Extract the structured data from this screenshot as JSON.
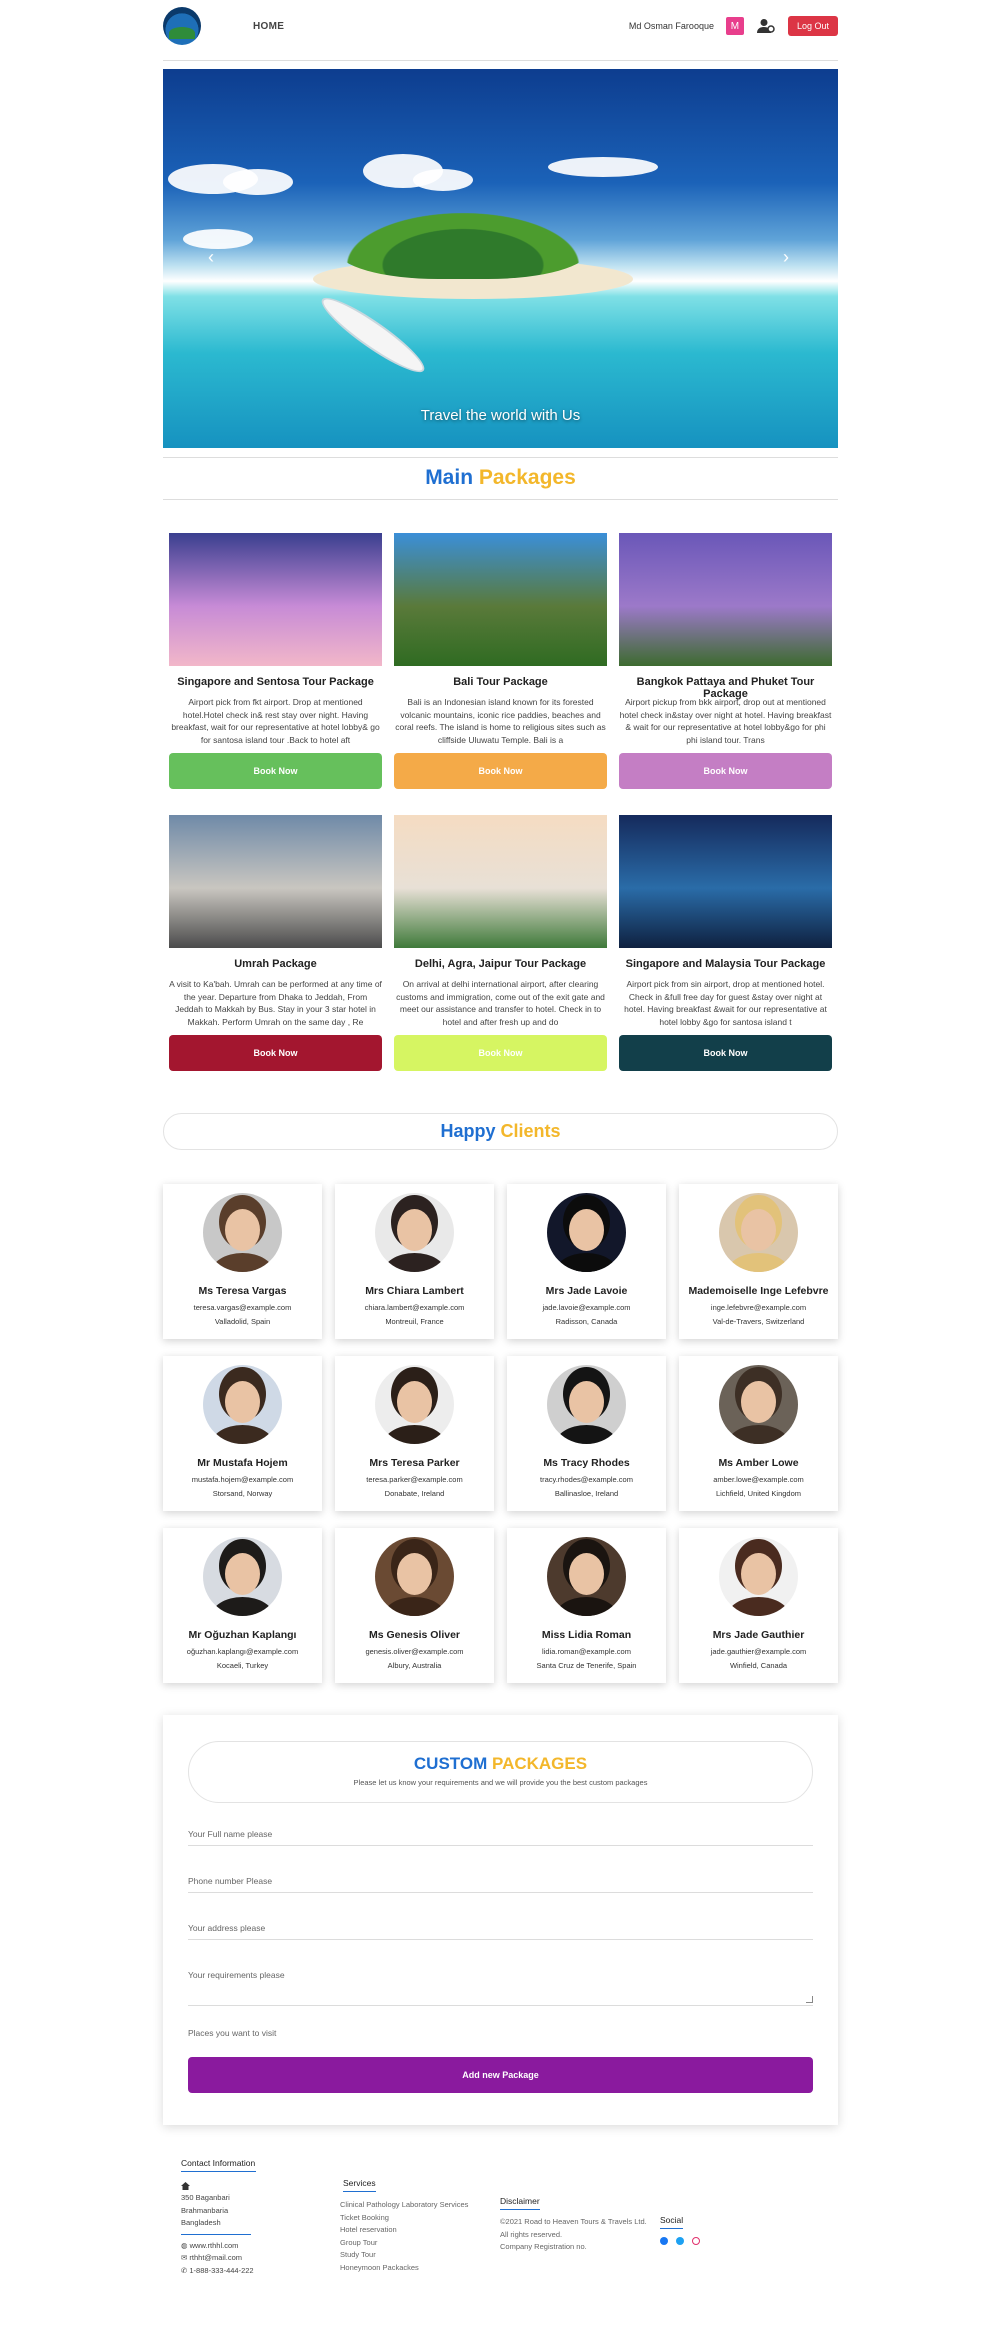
{
  "nav": {
    "home": "HOME",
    "user_name": "Md Osman Farooque",
    "avatar_letter": "M",
    "logout": "Log Out"
  },
  "hero": {
    "caption": "Travel the world with Us",
    "prev": "‹",
    "next": "›"
  },
  "packages_title": {
    "part1": "Main",
    "part2": "Packages"
  },
  "packages": [
    {
      "title": "Singapore and Sentosa Tour Package",
      "desc": "Airport pick from fkt airport. Drop at mentioned hotel.Hotel check in& rest stay over night. Having breakfast, wait for our representative at hotel lobby& go for santosa island tour .Back to hotel aft",
      "button": "Book Now",
      "btn_color": "#66c05c",
      "img": [
        "#3a3f8f",
        "#c78bd6",
        "#f2b7c9"
      ]
    },
    {
      "title": "Bali Tour Package",
      "desc": "Bali is an Indonesian island known for its forested volcanic mountains, iconic rice paddies, beaches and coral reefs. The island is home to religious sites such as cliffside Uluwatu Temple. Bali is a",
      "button": "Book Now",
      "btn_color": "#f4aa48",
      "img": [
        "#3b8fd8",
        "#5a7a3a",
        "#2f6b22"
      ]
    },
    {
      "title": "Bangkok Pattaya and Phuket Tour Package",
      "desc": "Airport pickup from bkk airport, drop out at mentioned hotel check in&stay over night at hotel. Having breakfast & wait for our representative at hotel lobby&go for phi phi island tour. Trans",
      "button": "Book Now",
      "btn_color": "#c47ec4",
      "img": [
        "#6a57b8",
        "#9c79c9",
        "#3d6b2f"
      ]
    },
    {
      "title": "Umrah Package",
      "desc": "A visit to Ka'bah. Umrah can be performed at any time of the year. Departure from Dhaka to Jeddah, From Jeddah to Makkah by Bus. Stay in your 3 star hotel in Makkah. Perform Umrah on the same day , Re",
      "button": "Book Now",
      "btn_color": "#a3162f",
      "img": [
        "#6f8aa8",
        "#c9c6c0",
        "#4b4b4b"
      ]
    },
    {
      "title": "Delhi, Agra, Jaipur Tour Package",
      "desc": "On arrival at delhi international airport, after clearing customs and immigration, come out of the exit gate and meet our assistance and transfer to hotel. Check in to hotel and after fresh up and do",
      "button": "Book Now",
      "btn_color": "#d6f562",
      "img": [
        "#f5dcc2",
        "#e8e0d6",
        "#3f7a3a"
      ]
    },
    {
      "title": "Singapore and Malaysia Tour Package",
      "desc": "Airport pick from sin airport, drop at mentioned hotel. Check in &full free day for guest &stay over night at hotel. Having breakfast &wait for our representative at hotel lobby &go for santosa island t",
      "button": "Book Now",
      "btn_color": "#123f4a",
      "img": [
        "#152a5c",
        "#2a6ca8",
        "#0f2140"
      ]
    }
  ],
  "clients_title": {
    "part1": "Happy",
    "part2": "Clients"
  },
  "clients": [
    {
      "name": "Ms Teresa Vargas",
      "email": "teresa.vargas@example.com",
      "location": "Valladolid, Spain",
      "bg": "#c8c8c8",
      "hair": "#5a3e2b"
    },
    {
      "name": "Mrs Chiara Lambert",
      "email": "chiara.lambert@example.com",
      "location": "Montreuil, France",
      "bg": "#e9e9e9",
      "hair": "#2c2220"
    },
    {
      "name": "Mrs Jade Lavoie",
      "email": "jade.lavoie@example.com",
      "location": "Radisson, Canada",
      "bg": "#12172a",
      "hair": "#0c0c0c"
    },
    {
      "name": "Mademoiselle Inge Lefebvre",
      "email": "inge.lefebvre@example.com",
      "location": "Val-de-Travers, Switzerland",
      "bg": "#d9c7ad",
      "hair": "#e2c27a"
    },
    {
      "name": "Mr Mustafa Hojem",
      "email": "mustafa.hojem@example.com",
      "location": "Storsand, Norway",
      "bg": "#cfd9e6",
      "hair": "#3b2a1f"
    },
    {
      "name": "Mrs Teresa Parker",
      "email": "teresa.parker@example.com",
      "location": "Donabate, Ireland",
      "bg": "#ededed",
      "hair": "#2b1f18"
    },
    {
      "name": "Ms Tracy Rhodes",
      "email": "tracy.rhodes@example.com",
      "location": "Ballinasloe, Ireland",
      "bg": "#cfcfcf",
      "hair": "#141414"
    },
    {
      "name": "Ms Amber Lowe",
      "email": "amber.lowe@example.com",
      "location": "Lichfield, United Kingdom",
      "bg": "#6b6258",
      "hair": "#3d2f25"
    },
    {
      "name": "Mr Oğuzhan Kaplangı",
      "email": "oğuzhan.kaplangı@example.com",
      "location": "Kocaeli, Turkey",
      "bg": "#d7dbe1",
      "hair": "#1d1b19"
    },
    {
      "name": "Ms Genesis Oliver",
      "email": "genesis.oliver@example.com",
      "location": "Albury, Australia",
      "bg": "#6a4a33",
      "hair": "#3a2518"
    },
    {
      "name": "Miss Lidia Roman",
      "email": "lidia.roman@example.com",
      "location": "Santa Cruz de Tenerife, Spain",
      "bg": "#4d3a2d",
      "hair": "#1a1410"
    },
    {
      "name": "Mrs Jade Gauthier",
      "email": "jade.gauthier@example.com",
      "location": "Winfield, Canada",
      "bg": "#f1f1f1",
      "hair": "#4a2b1f"
    }
  ],
  "custom": {
    "title1": "CUSTOM",
    "title2": "PACKAGES",
    "subtitle": "Please let us know your requirements and we will provide you the best custom packages",
    "name_placeholder": "Your Full name please",
    "phone_placeholder": "Phone number Please",
    "address_placeholder": "Your address please",
    "requirements_placeholder": "Your requirements please",
    "places_placeholder": "Places you want to visit",
    "submit": "Add new Package"
  },
  "footer": {
    "contact_head": "Contact Information",
    "addr1": "350 Baganbari",
    "addr2": "Brahmanbaria",
    "addr3": "Bangladesh",
    "web": "www.rthhl.com",
    "mail": "rthht@mail.com",
    "phone": "1-888-333-444-222",
    "services_head": "Services",
    "services": [
      "Clinical Pathology Laboratory Services",
      "Ticket Booking",
      "Hotel reservation",
      "Group Tour",
      "Study Tour",
      "Honeymoon Packackes"
    ],
    "disclaimer_head": "Disclaimer",
    "disclaimer1": "©2021 Road to Heaven Tours & Travels Ltd.",
    "disclaimer2": "All rights reserved.",
    "disclaimer3": "Company Registration no.",
    "social_head": "Social"
  }
}
